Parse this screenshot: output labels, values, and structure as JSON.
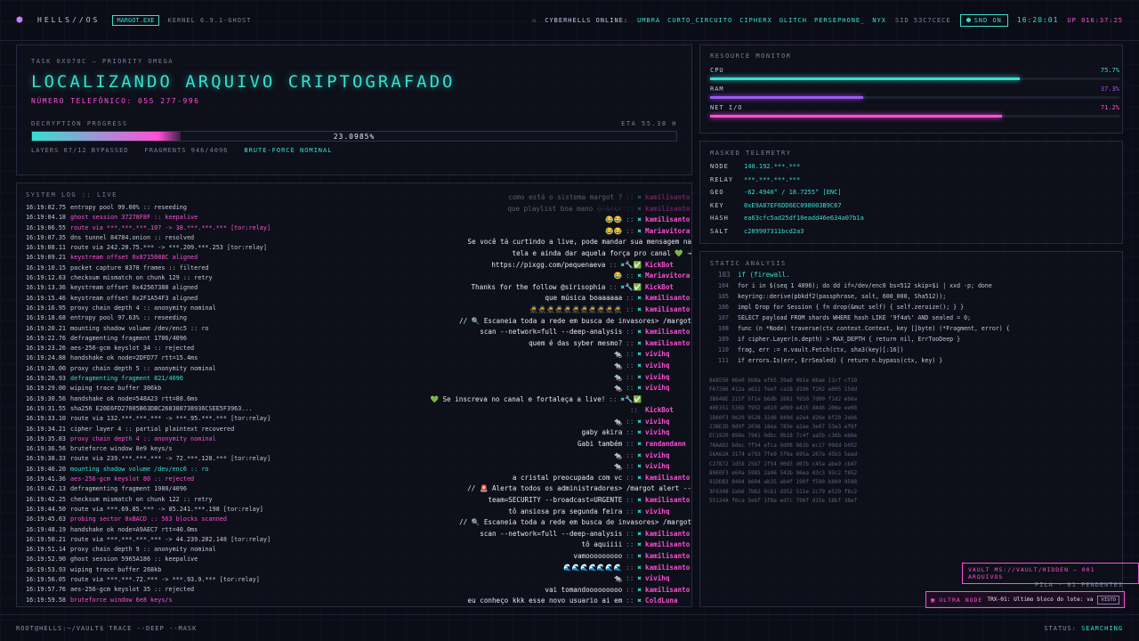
{
  "topbar": {
    "brand": "HELLS//OS",
    "badge": "MARGOT.EXE",
    "kernel": "KERNEL 6.9.1-GHOST",
    "online_label": "CYBERHELLS ONLINE:",
    "online_users": [
      "UMBRA",
      "CURTO_CIRCUITO",
      "CIPHERX",
      "GLITCH",
      "PERSEPHONE_",
      "NYX"
    ],
    "sid": "SID 53C7CECE",
    "snd": "SND ON",
    "clock": "16:20:01",
    "uptime": "UP 016:37:25"
  },
  "task": {
    "header": "TASK 0X070C — PRIORITY OMEGA",
    "title": "LOCALIZANDO ARQUIVO CRIPTOGRAFADO",
    "phone": "NÚMERO TELEFÔNICO: 055 277-996",
    "progress_label": "DECRYPTION PROGRESS",
    "eta": "ETA 55.38 H",
    "progress_text": "23.0985%",
    "progress_value": 0.230985,
    "layers": "LAYERS 07/12 BYPASSED",
    "fragments": "FRAGMENTS 946/4096",
    "bruteforce": "BRUTE-FORCE NOMINAL"
  },
  "log": {
    "title": "SYSTEM LOG :: LIVE",
    "lines": [
      {
        "ts": "16:19:02.75",
        "text": "entropy pool 99.00% :: reseeding",
        "c": ""
      },
      {
        "ts": "16:19:04.18",
        "text": "ghost session 37278F8F :: keepalive",
        "c": "pink"
      },
      {
        "ts": "16:19:06.55",
        "text": "route via ***.***.***.107 -> 38.***.***.*** [tor:relay]",
        "c": "pink"
      },
      {
        "ts": "16:19:07.35",
        "text": "dns tunnel 84784.onion :: resolved",
        "c": ""
      },
      {
        "ts": "16:19:08.11",
        "text": "route via 242.20.75.*** -> ***.209.***.253 [tor:relay]",
        "c": ""
      },
      {
        "ts": "16:19:09.21",
        "text": "keystream offset 0x8715088C aligned",
        "c": "pink"
      },
      {
        "ts": "16:19:10.15",
        "text": "packet capture 8378 frames :: filtered",
        "c": ""
      },
      {
        "ts": "16:19:12.63",
        "text": "checksum mismatch on chunk 129 :: retry",
        "c": ""
      },
      {
        "ts": "16:19:13.36",
        "text": "keystream offset 0x42567388 aligned",
        "c": ""
      },
      {
        "ts": "16:19:15.46",
        "text": "keystream offset 0x2F1A54F3 aligned",
        "c": ""
      },
      {
        "ts": "16:19:16.95",
        "text": "proxy chain depth 4 :: anonymity nominal",
        "c": ""
      },
      {
        "ts": "16:19:18.68",
        "text": "entropy pool 97.63% :: reseeding",
        "c": ""
      },
      {
        "ts": "16:19:20.21",
        "text": "mounting shadow volume /dev/enc5 :: ro",
        "c": ""
      },
      {
        "ts": "16:19:22.76",
        "text": "defragmenting fragment 1706/4096",
        "c": ""
      },
      {
        "ts": "16:19:23.26",
        "text": "aes-256-gcm keyslot 34 :: rejected",
        "c": ""
      },
      {
        "ts": "16:19:24.88",
        "text": "handshake ok node=2DFD77 rtt=15.4ms",
        "c": ""
      },
      {
        "ts": "16:19:26.00",
        "text": "proxy chain depth 5 :: anonymity nominal",
        "c": ""
      },
      {
        "ts": "16:19:26.93",
        "text": "defragmenting fragment 821/4096",
        "c": "cyan"
      },
      {
        "ts": "16:19:29.00",
        "text": "wiping trace buffer 306kb",
        "c": ""
      },
      {
        "ts": "16:19:30.56",
        "text": "handshake ok node=548A23 rtt=88.6ms",
        "c": ""
      },
      {
        "ts": "16:19:31.55",
        "text": "sha256 E20E6FD27005B63DBC268388738936CSEE5F3963...",
        "c": ""
      },
      {
        "ts": "16:19:33.10",
        "text": "route via 132.***.***.*** -> ***.95.***.*** [tor:relay]",
        "c": ""
      },
      {
        "ts": "16:19:34.21",
        "text": "cipher layer 4 :: partial plaintext recovered",
        "c": ""
      },
      {
        "ts": "16:19:35.83",
        "text": "proxy chain depth 4 :: anonymity nominal",
        "c": "pink"
      },
      {
        "ts": "16:19:36.56",
        "text": "bruteforce window 8e9 keys/s",
        "c": ""
      },
      {
        "ts": "16:19:38.33",
        "text": "route via 239.***.***.*** -> 72.***.128.*** [tor:relay]",
        "c": ""
      },
      {
        "ts": "16:19:40.20",
        "text": "mounting shadow volume /dev/enc6 :: ro",
        "c": "cyan"
      },
      {
        "ts": "16:19:41.36",
        "text": "aes-256-gcm keyslot 80 :: rejected",
        "c": "pink"
      },
      {
        "ts": "16:19:42.13",
        "text": "defragmenting fragment 1980/4096",
        "c": ""
      },
      {
        "ts": "16:19:42.25",
        "text": "checksum mismatch on chunk 122 :: retry",
        "c": ""
      },
      {
        "ts": "16:19:44.50",
        "text": "route via ***.69.85.*** -> 85.241.***.198 [tor:relay]",
        "c": ""
      },
      {
        "ts": "16:19:45.63",
        "text": "probing sector 0xBACD :: 563 blocks scanned",
        "c": "pink"
      },
      {
        "ts": "16:19:48.19",
        "text": "handshake ok node=A9AEC7 rtt=40.0ms",
        "c": ""
      },
      {
        "ts": "16:19:50.21",
        "text": "route via ***.***.***.*** -> 44.239.202.148 [tor:relay]",
        "c": ""
      },
      {
        "ts": "16:19:51.14",
        "text": "proxy chain depth 9 :: anonymity nominal",
        "c": ""
      },
      {
        "ts": "16:19:52.90",
        "text": "ghost session 5965A186 :: keepalive",
        "c": ""
      },
      {
        "ts": "16:19:53.93",
        "text": "wiping trace buffer 268kb",
        "c": ""
      },
      {
        "ts": "16:19:56.05",
        "text": "route via ***.***.72.*** -> ***.93.9.*** [tor:relay]",
        "c": ""
      },
      {
        "ts": "16:19:57.76",
        "text": "aes-256-gcm keyslot 35 :: rejected",
        "c": ""
      },
      {
        "ts": "16:19:59.58",
        "text": "bruteforce window 6e8 keys/s",
        "c": "pink"
      }
    ]
  },
  "chat": [
    {
      "msg": "como está o sistema margot ?",
      "tags": "✖",
      "user": "kamilisanto",
      "f": true
    },
    {
      "msg": "que playlist boa mano 🎶🎶🎶",
      "tags": "✖",
      "user": "kamilisanto",
      "f": true
    },
    {
      "msg": "😂😂",
      "tags": "✖",
      "user": "kamilisanto",
      "f": false
    },
    {
      "msg": "😂😂",
      "tags": "✖",
      "user": "Mariavitora",
      "f": false
    },
    {
      "msg": "Se você tá curtindo a live, pode mandar sua mensagem na",
      "tags": "",
      "user": "",
      "f": false
    },
    {
      "msg": "tela e ainda dar aquela força pro canal 💚 →",
      "tags": "",
      "user": "",
      "f": false
    },
    {
      "msg": "https://pixgg.com/pequenaeva",
      "tags": "✖🔧✅",
      "user": "KickBot",
      "f": false
    },
    {
      "msg": "😂",
      "tags": "✖",
      "user": "Mariavitora",
      "f": false
    },
    {
      "msg": "Thanks for the follow @sirisophia",
      "tags": "✖🔧✅",
      "user": "KickBot",
      "f": false
    },
    {
      "msg": "que música boaaaaaa",
      "tags": "✖",
      "user": "kamilisanto",
      "f": false
    },
    {
      "msg": "🥷🥷🥷🥷🥷🥷🥷🥷🥷🥷🥷",
      "tags": "✖",
      "user": "kamilisanto",
      "f": false
    },
    {
      "msg": "// 🔍 Escaneia toda a rede em busca de invasores> /margot",
      "tags": "",
      "user": "",
      "f": false
    },
    {
      "msg": "scan --network=full --deep-analysis",
      "tags": "✖",
      "user": "kamilisanto",
      "f": false
    },
    {
      "msg": "quem é das syber mesmo?",
      "tags": "✖",
      "user": "kamilisanto",
      "f": false
    },
    {
      "msg": "🐀",
      "tags": "✖",
      "user": "vivihq",
      "f": false
    },
    {
      "msg": "🐀",
      "tags": "✖",
      "user": "vivihq",
      "f": false
    },
    {
      "msg": "🐀",
      "tags": "✖",
      "user": "vivihq",
      "f": false
    },
    {
      "msg": "🐀",
      "tags": "✖",
      "user": "vivihq",
      "f": false
    },
    {
      "msg": "💚 Se inscreva no canal e fortaleça a live!",
      "tags": "✖🔧✅",
      "user": "",
      "f": false
    },
    {
      "msg": "",
      "tags": "",
      "user": "KickBot",
      "f": false
    },
    {
      "msg": "🐀",
      "tags": "✖",
      "user": "vivihq",
      "f": false
    },
    {
      "msg": "gaby akira",
      "tags": "✖",
      "user": "vivihq",
      "f": false
    },
    {
      "msg": "Gabi também",
      "tags": "✖",
      "user": "randandann",
      "f": false
    },
    {
      "msg": "🐀",
      "tags": "✖",
      "user": "vivihq",
      "f": false
    },
    {
      "msg": "🐀",
      "tags": "✖",
      "user": "vivihq",
      "f": false
    },
    {
      "msg": "a cristal preocupada com vc",
      "tags": "✖",
      "user": "kamilisanto",
      "f": false
    },
    {
      "msg": "// 🚨 Alerta todos os administradores> /margot alert --",
      "tags": "",
      "user": "",
      "f": false
    },
    {
      "msg": "team=SECURITY --broadcast=URGENTE",
      "tags": "✖",
      "user": "kamilisanto",
      "f": false
    },
    {
      "msg": "tô ansiosa pra segunda feira",
      "tags": "✖",
      "user": "vivihq",
      "f": false
    },
    {
      "msg": "// 🔍 Escaneia toda a rede em busca de invasores> /margot",
      "tags": "",
      "user": "",
      "f": false
    },
    {
      "msg": "scan --network=full --deep-analysis",
      "tags": "✖",
      "user": "kamilisanto",
      "f": false
    },
    {
      "msg": "tô aquiiii",
      "tags": "✖",
      "user": "kamilisanto",
      "f": false
    },
    {
      "msg": "vamooooooooo",
      "tags": "✖",
      "user": "kamilisanto",
      "f": false
    },
    {
      "msg": "🌊🌊🌊🌊🌊🌊🌊",
      "tags": "✖",
      "user": "kamilisanto",
      "f": false
    },
    {
      "msg": "🐀",
      "tags": "✖",
      "user": "vivihq",
      "f": false
    },
    {
      "msg": "vai tomandooooooooo",
      "tags": "✖",
      "user": "kamilisanto",
      "f": false
    },
    {
      "msg": "eu conheço kkk esse novo usuario ai em",
      "tags": "✖",
      "user": "ColdLuna",
      "f": false
    }
  ],
  "resources": {
    "title": "RESOURCE MONITOR",
    "items": [
      {
        "label": "CPU",
        "value": "75.7%",
        "fraction": 0.757,
        "color": "#35e0d0"
      },
      {
        "label": "RAM",
        "value": "37.3%",
        "fraction": 0.373,
        "color": "#9b59f0"
      },
      {
        "label": "NET I/O",
        "value": "71.2%",
        "fraction": 0.712,
        "color": "#ff4fd8"
      }
    ]
  },
  "telemetry": {
    "title": "MASKED TELEMETRY",
    "rows": [
      {
        "k": "NODE",
        "v": "140.192.***.***"
      },
      {
        "k": "RELAY",
        "v": "***.***.***.***"
      },
      {
        "k": "GEO",
        "v": "-62.4940° / 18.7255° [ENC]"
      },
      {
        "k": "KEY",
        "v": "0xE9A87EF6DD6EC098003B9C67"
      },
      {
        "k": "HASH",
        "v": "ea63cfc5ad25df10eadd46e634a07b1a"
      },
      {
        "k": "SALT",
        "v": "c289907311bcd2a3"
      }
    ]
  },
  "analysis": {
    "title": "STATIC ANALYSIS",
    "code": [
      {
        "ln": "103",
        "t": "if (firewall.",
        "hl": true
      },
      {
        "ln": "104",
        "t": "for i in $(seq 1 4096); do dd if=/dev/enc0 bs=512 skip=$i | xxd -p; done",
        "hl": false
      },
      {
        "ln": "105",
        "t": "keyring::derive(pbkdf2(passphrase, salt, 600_000, Sha512));",
        "hl": false
      },
      {
        "ln": "106",
        "t": "impl Drop for Session { fn drop(&mut self) { self.zeroize(); } }",
        "hl": false
      },
      {
        "ln": "107",
        "t": "SELECT payload FROM shards WHERE hash LIKE '9f4a%' AND sealed = 0;",
        "hl": false
      },
      {
        "ln": "108",
        "t": "func (n *Node) traverse(ctx context.Context, key []byte) (*Fragment, error) {",
        "hl": false
      },
      {
        "ln": "109",
        "t": "if cipher.Layer(n.depth) > MAX_DEPTH { return nil, ErrTooDeep }",
        "hl": false
      },
      {
        "ln": "110",
        "t": "frag, err := n.vault.Fetch(ctx, sha3(key)[:16])",
        "hl": false
      },
      {
        "ln": "111",
        "t": "if errors.Is(err, ErrSealed) { return n.bypass(ctx, key) }",
        "hl": false
      }
    ],
    "hexdump": [
      "8A8550 06e0 bb8a ef65 39a0 0b1e 6bae 11cf cf19",
      "F67266 412a a611 feef ca18 d196 f202 e005 15dd",
      "3B648E 215f 5f1e b6db 2681 f650 7d00 f1d2 eb6a",
      "40E351 536b f952 e810 a0b9 e435 d4d6 206e ee08",
      "1D60F3 0e20 b528 32d6 849d a2e4 d26e bf20 2eb6",
      "23BE2D 0d9f 2036 18ea 783e a2ae 3e07 53e3 ef6f",
      "EC1920 898e 7961 0dbc 0b18 7c4f aa5b c36b e66e",
      "78AAD2 bdec ff54 efca 0d08 863b ec17 09dd b052",
      "56A62A 3174 e793 7fe9 5f6a 695a 267a 45b3 5ead",
      "C27872 1d58 25b7 2f54 00d3 d07b c45a abe9 cb47",
      "80E0F3 e60a 5985 2a06 543b 06ea 43c3 93c2 f852",
      "91DDB3 0404 b604 ab35 ab4f 190f f590 b800 9588",
      "3F6348 2ab6 7bb2 0cb1 d352 511e 2c79 e529 f8c2",
      "55134A f6ca 5e6f 1f8a ed7c 796f d15e 18bf 38ef"
    ]
  },
  "vault": "VAULT MS://VAULT/HIDDEN — 001 ARQUIVOS",
  "fila": "FILA · 01 PENDENTES",
  "ultra": {
    "label": "ULTRA NODE",
    "message": "TRX-01: Último bloco do lote: va…",
    "visto": "VISTO"
  },
  "bottombar": {
    "prompt": "ROOT@HELLS:~/VAULT$ TRACE --DEEP --MASK",
    "status_label": "STATUS:",
    "status": "SEARCHING"
  }
}
